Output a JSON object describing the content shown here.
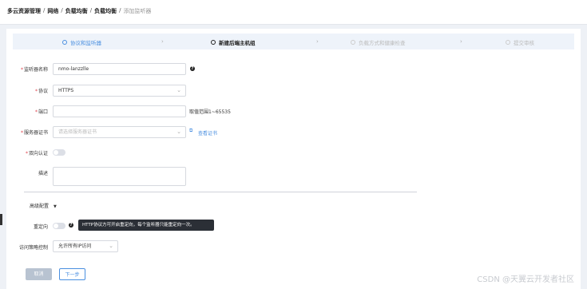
{
  "breadcrumb": {
    "items": [
      "多云资源管理",
      "网络",
      "负载均衡",
      "负载均衡"
    ],
    "current": "添加监听器"
  },
  "steps": [
    {
      "label": "协议和监听器",
      "state": "done"
    },
    {
      "label": "新建后端主机组",
      "state": "active"
    },
    {
      "label": "负载方式和健康检查",
      "state": "todo"
    },
    {
      "label": "提交审核",
      "state": "todo"
    }
  ],
  "form": {
    "listener_name": {
      "label": "监听器名称",
      "value": "nmo-lanzzlle"
    },
    "protocol": {
      "label": "协议",
      "value": "HTTPS"
    },
    "port": {
      "label": "端口",
      "value": "",
      "range_hint": "取值范围1~65535"
    },
    "server_cert": {
      "label": "服务器证书",
      "placeholder": "请选择服务器证书",
      "view_link": "查看证书"
    },
    "mutual_auth": {
      "label": "双向认证"
    },
    "description": {
      "label": "描述",
      "value": ""
    },
    "advanced": {
      "label": "高级配置"
    },
    "redirect": {
      "label": "重定向",
      "tooltip": "HTTP协议方可开启重定向，每个监听器只能重定向一次。"
    },
    "access_control": {
      "label": "访问策略控制",
      "value": "允许所有IP访问"
    }
  },
  "buttons": {
    "cancel": "取消",
    "next": "下一步"
  },
  "watermark": "CSDN @天翼云开发者社区"
}
